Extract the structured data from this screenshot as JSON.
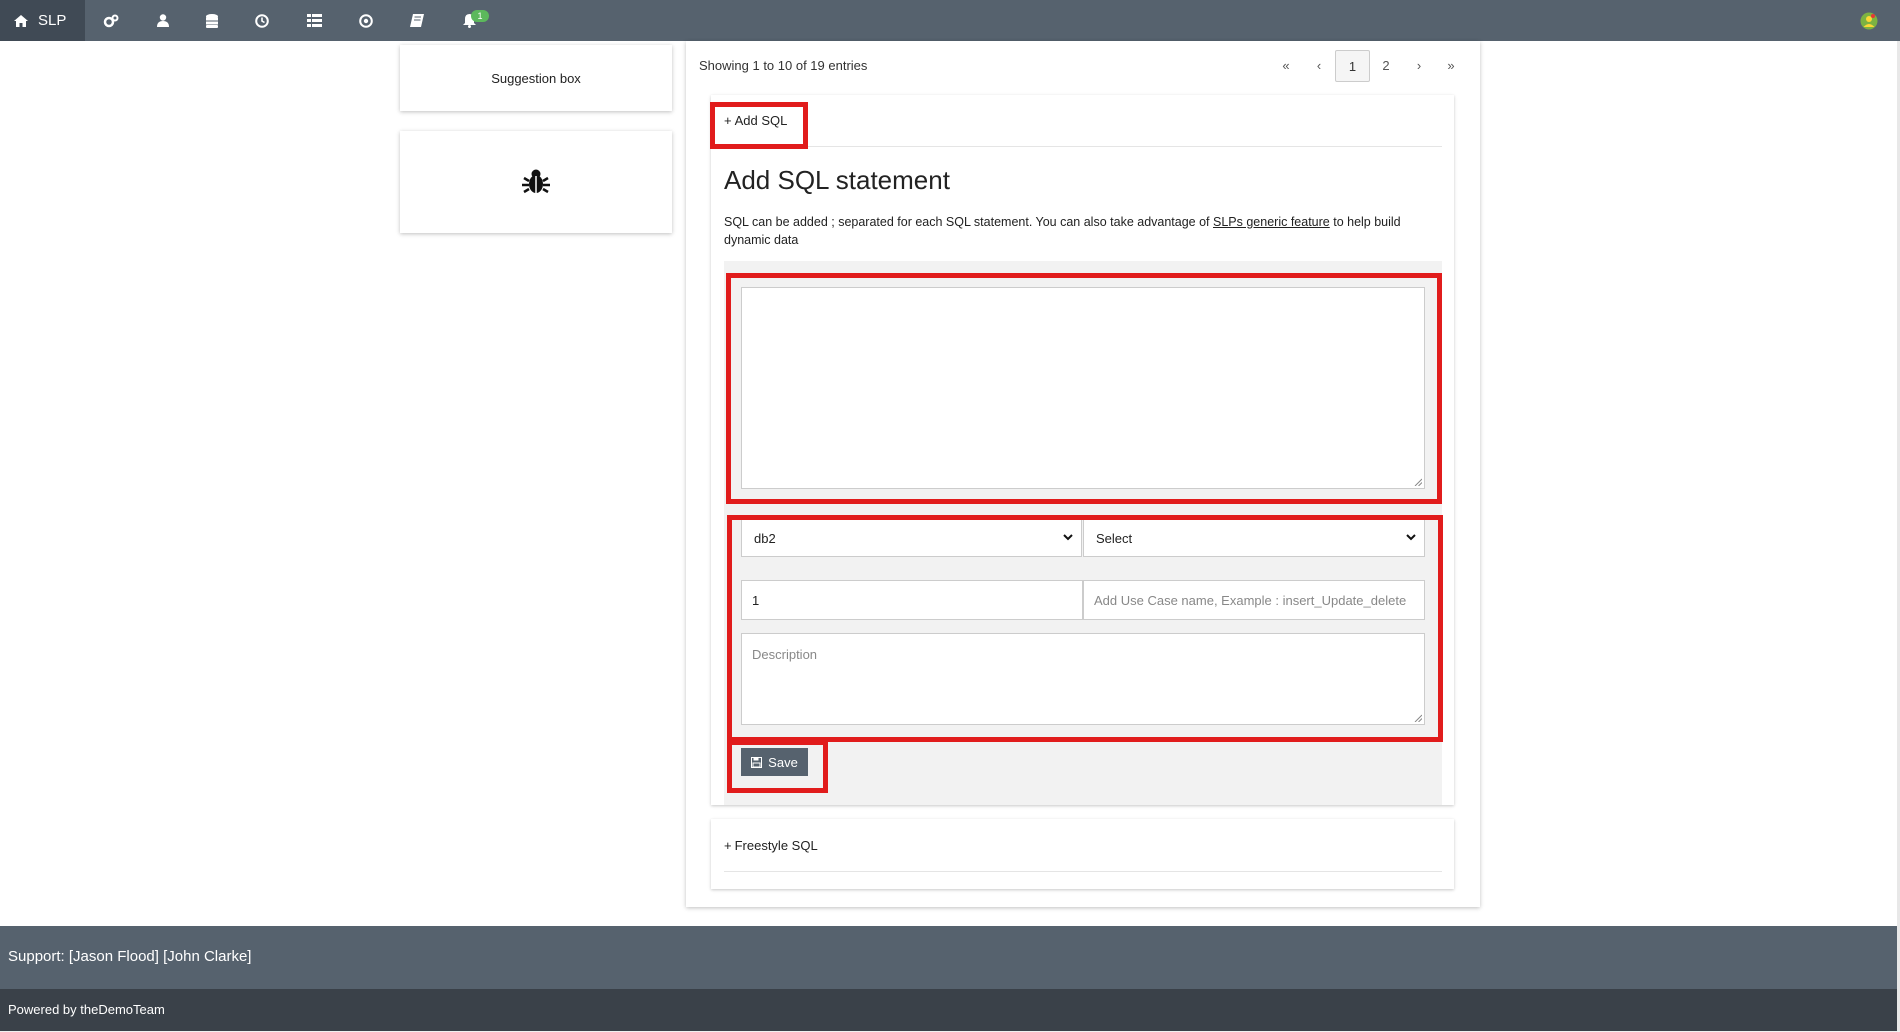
{
  "nav": {
    "brand": "SLP",
    "icons": [
      "home-icon",
      "cogs-icon",
      "user-icon",
      "database-icon",
      "clock-icon",
      "list-icon",
      "target-icon",
      "book-icon",
      "bell-icon"
    ],
    "notification_count": "1"
  },
  "sidebar": {
    "suggestion_label": "Suggestion box"
  },
  "main": {
    "showing": "Showing 1 to 10 of 19 entries",
    "pagination": [
      "«",
      "‹",
      "1",
      "2",
      "›",
      "»"
    ],
    "current_page": "1",
    "add_sql_link": "Add SQL",
    "title": "Add SQL statement",
    "desc_prefix": "SQL can be added ; separated for each SQL statement. You can also take advantage of ",
    "desc_link": "SLPs generic feature",
    "desc_suffix": " to help build dynamic data",
    "db_select_value": "db2",
    "type_select_value": "Select",
    "number_value": "1",
    "usecase_placeholder": "Add Use Case name, Example : insert_Update_delete",
    "description_placeholder": "Description",
    "save_label": "Save",
    "freestyle_link": "Freestyle SQL"
  },
  "footer": {
    "support": "Support: [Jason Flood] [John Clarke]",
    "powered": "Powered by theDemoTeam"
  },
  "colors": {
    "nav_bg": "#56626e",
    "brand_bg": "#404a55",
    "highlight": "#e11c1c",
    "badge": "#5cb85c"
  }
}
